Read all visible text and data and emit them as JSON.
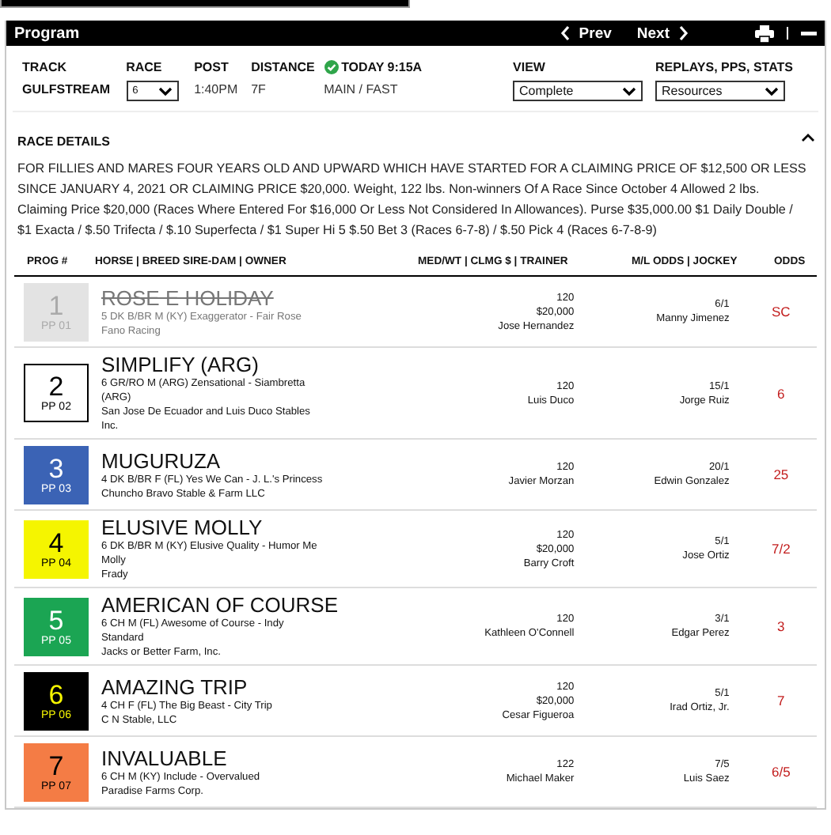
{
  "header": {
    "title": "Program",
    "prev": "Prev",
    "next": "Next"
  },
  "info": {
    "track_label": "TRACK",
    "track": "GULFSTREAM",
    "race_label": "RACE",
    "race": "6",
    "post_label": "POST",
    "post": "1:40PM",
    "distance_label": "DISTANCE",
    "distance": "7F",
    "status": "TODAY 9:15A",
    "surface": "MAIN / FAST",
    "view_label": "VIEW",
    "view": "Complete",
    "resources_label": "REPLAYS, PPS, STATS",
    "resources": "Resources"
  },
  "race_details": {
    "title": "RACE DETAILS",
    "expanded": true,
    "text": "FOR FILLIES AND MARES FOUR YEARS OLD AND UPWARD WHICH HAVE STARTED FOR A CLAIMING PRICE OF $12,500 OR LESS SINCE JANUARY 4, 2021 OR CLAIMING PRICE $20,000. Weight, 122 lbs. Non-winners Of A Race Since October 4 Allowed 2 lbs. Claiming Price $20,000 (Races Where Entered For $16,000 Or Less Not Considered In Allowances). Purse $35,000.00 $1 Daily Double / $1 Exacta / $.50 Trifecta / $.10 Superfecta / $1 Super Hi 5 $.50 Bet 3 (Races 6-7-8) / $.50 Pick 4 (Races 6-7-8-9)"
  },
  "columns": [
    "PROG #",
    "HORSE | BREED SIRE-DAM | OWNER",
    "MED/WT | CLMG $ | TRAINER",
    "M/L ODDS | JOCKEY",
    "ODDS"
  ],
  "entries": [
    {
      "prog": "1",
      "pp": "PP 01",
      "color": "#e3e3e3",
      "scratched": true,
      "horse": "ROSE E HOLIDAY",
      "breed": "5 DK B/BR M (KY) Exaggerator - Fair Rose",
      "owner": "Fano Racing",
      "weight": "120",
      "claiming": "$20,000",
      "trainer": "Jose Hernandez",
      "ml_odds": "6/1",
      "jockey": "Manny Jimenez",
      "odds": "SC"
    },
    {
      "prog": "2",
      "pp": "PP 02",
      "color": "#ffffff",
      "scratched": false,
      "horse": "SIMPLIFY (ARG)",
      "breed": "6 GR/RO M (ARG) Zensational - Siambretta (ARG)",
      "owner": "San Jose De Ecuador and Luis Duco Stables Inc.",
      "weight": "120",
      "trainer": "Luis Duco",
      "ml_odds": "15/1",
      "jockey": "Jorge Ruiz",
      "odds": "6"
    },
    {
      "prog": "3",
      "pp": "PP 03",
      "color": "#3b63b5",
      "scratched": false,
      "horse": "MUGURUZA",
      "breed": "4 DK B/BR F (FL) Yes We Can - J. L.'s Princess",
      "owner": "Chuncho Bravo Stable & Farm LLC",
      "weight": "120",
      "trainer": "Javier Morzan",
      "ml_odds": "20/1",
      "jockey": "Edwin Gonzalez",
      "odds": "25"
    },
    {
      "prog": "4",
      "pp": "PP 04",
      "color": "#f5f500",
      "scratched": false,
      "horse": "ELUSIVE MOLLY",
      "breed": "6 DK B/BR M (KY) Elusive Quality - Humor Me Molly",
      "owner": "Frady",
      "weight": "120",
      "claiming": "$20,000",
      "trainer": "Barry Croft",
      "ml_odds": "5/1",
      "jockey": "Jose Ortiz",
      "odds": "7/2"
    },
    {
      "prog": "5",
      "pp": "PP 05",
      "color": "#1ba553",
      "scratched": false,
      "horse": "AMERICAN OF COURSE",
      "breed": "6 CH M (FL) Awesome of Course - Indy Standard",
      "owner": "Jacks or Better Farm, Inc.",
      "weight": "120",
      "trainer": "Kathleen O'Connell",
      "ml_odds": "3/1",
      "jockey": "Edgar Perez",
      "odds": "3"
    },
    {
      "prog": "6",
      "pp": "PP 06",
      "color": "#000000",
      "scratched": false,
      "horse": "AMAZING TRIP",
      "breed": "4 CH F (FL) The Big Beast - City Trip",
      "owner": "C N Stable, LLC",
      "weight": "120",
      "claiming": "$20,000",
      "trainer": "Cesar Figueroa",
      "ml_odds": "5/1",
      "jockey": "Irad Ortiz, Jr.",
      "odds": "7"
    },
    {
      "prog": "7",
      "pp": "PP 07",
      "color": "#f47c45",
      "scratched": false,
      "horse": "INVALUABLE",
      "breed": "6 CH M (KY) Include - Overvalued",
      "owner": "Paradise Farms Corp.",
      "weight": "122",
      "trainer": "Michael Maker",
      "ml_odds": "7/5",
      "jockey": "Luis Saez",
      "odds": "6/5"
    }
  ]
}
